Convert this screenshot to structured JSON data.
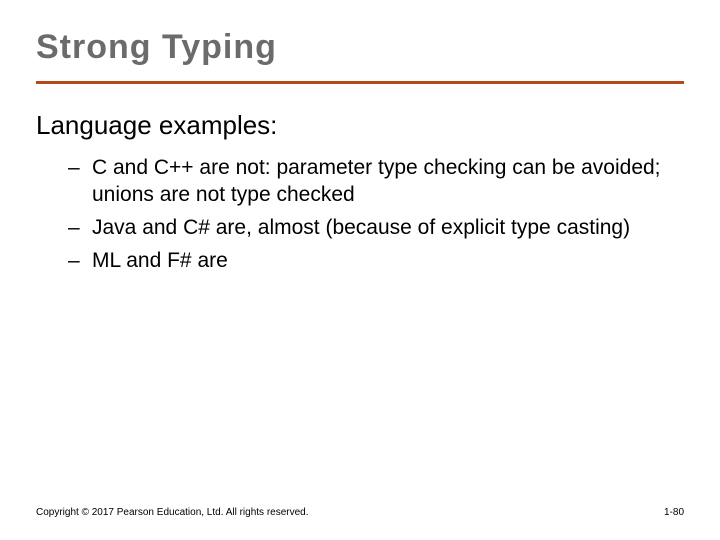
{
  "title": "Strong Typing",
  "subtitle": "Language examples:",
  "bullets": [
    "C and C++ are not: parameter type checking can be avoided; unions are not type checked",
    "Java and C# are, almost (because of explicit type casting)",
    "ML and F# are"
  ],
  "footer": {
    "copyright": "Copyright © 2017 Pearson Education, Ltd. All rights reserved.",
    "page": "1-80"
  }
}
